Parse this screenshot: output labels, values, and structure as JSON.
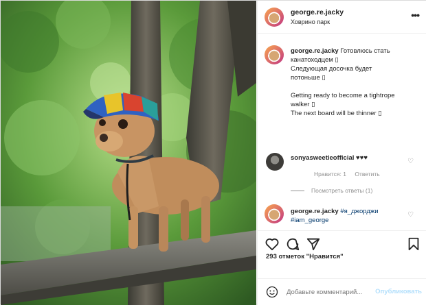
{
  "post": {
    "username": "george.re.jacky",
    "location": "Ховрино парк",
    "more_label": "•••",
    "caption": {
      "username": "george.re.jacky",
      "lines": [
        "Готовлюсь стать",
        "канатоходцем ▯",
        "Следующая досочка будет",
        "потоньше ▯",
        "Getting ready to become a tightrope",
        "walker ▯",
        "The next board will be thinner ▯"
      ]
    },
    "comments": [
      {
        "username": "sonyasweetieofficial",
        "text": "♥♥♥",
        "likes_label": "Нравится: 1",
        "reply_label": "Ответить"
      },
      {
        "username": "george.re.jacky",
        "text": "#я_джорджи #iam_george"
      }
    ],
    "view_replies": "Посмотреть ответы (1)",
    "likes_text": "293 отметок \"Нравится\"",
    "add_comment_placeholder": "Добавьте комментарий...",
    "publish_label": "Опубликовать"
  },
  "icons": {
    "like": "heart-icon",
    "comment": "comment-icon",
    "share": "send-icon",
    "save": "bookmark-icon",
    "emoji": "smile-icon"
  }
}
